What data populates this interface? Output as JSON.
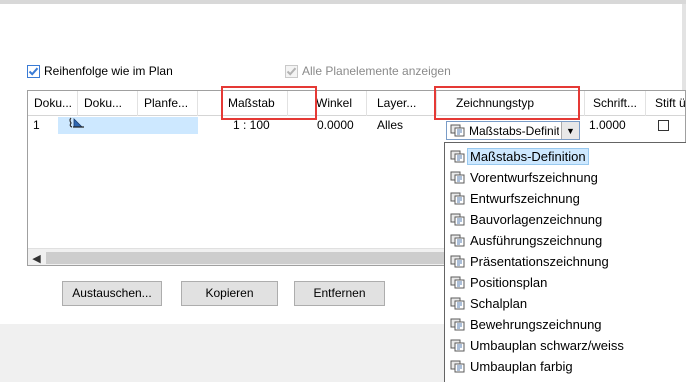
{
  "options": {
    "order_in_plan": {
      "label": "Reihenfolge wie im Plan",
      "checked": true
    },
    "show_all": {
      "label": "Alle Planelemente anzeigen",
      "checked": true,
      "disabled": true
    }
  },
  "table": {
    "columns": [
      "Doku...",
      "Doku...",
      "Planfe...",
      "Maßstab",
      "Winkel",
      "Layer...",
      "Zeichnungstyp",
      "Schrift...",
      "Stift ü"
    ],
    "row": {
      "num": "1",
      "doc_icon": "document-link-icon",
      "scale": "1 : 100",
      "angle": "0.0000",
      "layer": "Alles",
      "drawing_type": "Maßstabs-Definition",
      "font": "1.0000",
      "pen_override": false
    },
    "highlighted_columns": [
      "Maßstab",
      "Zeichnungstyp"
    ]
  },
  "buttons": {
    "replace": "Austauschen...",
    "copy": "Kopieren",
    "remove": "Entfernen"
  },
  "dropdown": {
    "selected_index": 0,
    "items": [
      "Maßstabs-Definition",
      "Vorentwurfszeichnung",
      "Entwurfszeichnung",
      "Bauvorlagenzeichnung",
      "Ausführungszeichnung",
      "Präsentationszeichnung",
      "Positionsplan",
      "Schalplan",
      "Bewehrungszeichnung",
      "Umbauplan schwarz/weiss",
      "Umbauplan farbig"
    ]
  },
  "colors": {
    "highlight_box": "#e53935",
    "selection": "#cde8ff",
    "check": "#3a7bd5"
  }
}
